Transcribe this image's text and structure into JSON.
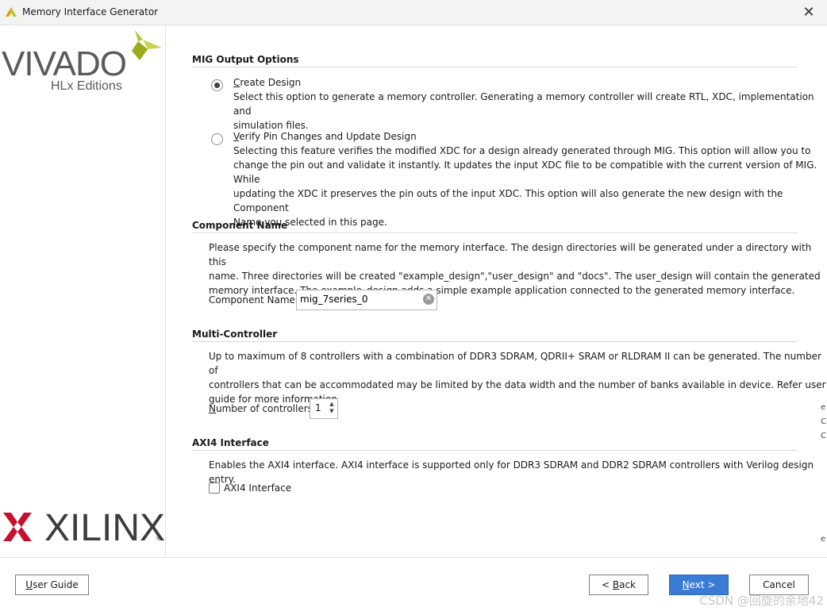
{
  "window": {
    "title": "Memory Interface Generator",
    "close_glyph": "✕"
  },
  "branding": {
    "vivado_word": "VIVADO",
    "vivado_sub": "HLx Editions",
    "xilinx_word": "XILINX",
    "xilinx_reg": "®",
    "vivado_accent": "#b5c334",
    "xilinx_red": "#c8102e"
  },
  "output_options": {
    "title": "MIG Output Options",
    "create": {
      "label_first": "C",
      "label_rest": "reate Design",
      "selected": true,
      "desc_lines": [
        "Select this option to generate a memory controller. Generating a memory controller will create RTL, XDC, implementation and",
        "simulation files."
      ]
    },
    "verify": {
      "label_first": "V",
      "label_rest": "erify Pin Changes and Update Design",
      "selected": false,
      "desc_lines": [
        "Selecting this feature verifies the modified XDC for a design already generated through MIG. This option will allow you to",
        "change the pin out and validate it instantly. It updates the input XDC file to be compatible with the current version of MIG. While",
        "updating the XDC it preserves the pin outs of the input XDC. This option will also generate the new design with the Component",
        "Name you selected in this page."
      ]
    }
  },
  "component": {
    "title": "Component Name",
    "desc_lines": [
      "Please specify the component name for the memory interface. The design directories will be generated under a directory with this",
      "name. Three directories will be created \"example_design\",\"user_design\" and \"docs\". The user_design will contain the generated",
      "memory interface. The example_design adds a simple example application connected to the generated memory interface."
    ],
    "field_label": "Component Name",
    "value": "mig_7series_0",
    "clear_glyph": "✕"
  },
  "multi": {
    "title": "Multi-Controller",
    "desc_lines": [
      "Up to maximum of 8 controllers with a combination of DDR3 SDRAM, QDRII+ SRAM or RLDRAM II can be generated. The number of",
      "controllers that can be accommodated may be limited by the data width and the number of banks available in device. Refer user",
      "guide for more information"
    ],
    "label_first": "N",
    "label_rest": "umber of controllers",
    "value": "1",
    "up_glyph": "▲",
    "down_glyph": "▼"
  },
  "axi": {
    "title": "AXI4 Interface",
    "desc": "Enables the AXI4 interface. AXI4 interface is supported only for DDR3 SDRAM and DDR2 SDRAM controllers with Verilog design entry.",
    "checkbox_label": "AXI4 Interface",
    "checked": false
  },
  "footer": {
    "user_guide_first": "U",
    "user_guide_rest": "ser Guide",
    "back_prefix": "< ",
    "back_first": "B",
    "back_rest": "ack",
    "next_first": "N",
    "next_rest": "ext >",
    "cancel": "Cancel",
    "primary_color": "#3a7bd5"
  },
  "watermark": "CSDN @回旋的余地42",
  "edge_glyphs": [
    "e",
    "C",
    "C",
    "e"
  ]
}
